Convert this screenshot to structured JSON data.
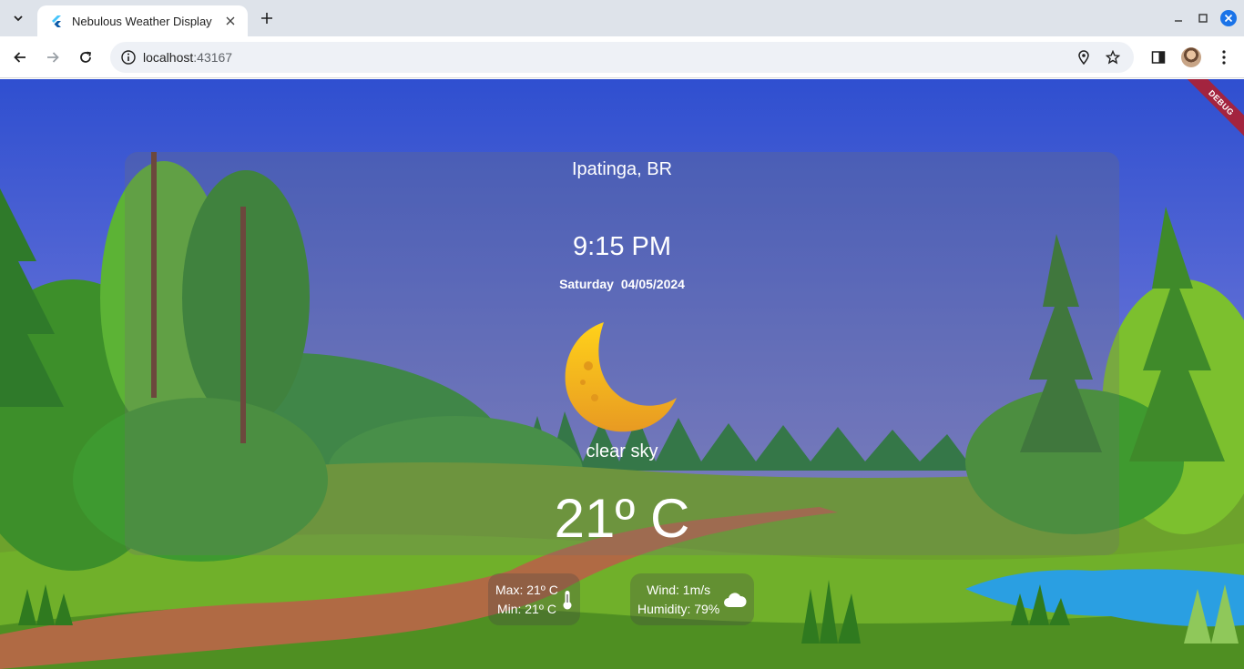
{
  "browser": {
    "tab_title": "Nebulous Weather Display",
    "url_host": "localhost",
    "url_port": ":43167"
  },
  "app": {
    "debug_label": "DEBUG",
    "city": "Ipatinga, BR",
    "time": "9:15 PM",
    "date": "Saturday  04/05/2024",
    "condition": "clear sky",
    "temperature": "21º C",
    "max_temp": "Max: 21º C",
    "min_temp": "Min: 21º C",
    "wind": "Wind: 1m/s",
    "humidity": "Humidity: 79%"
  },
  "icons": {
    "weather": "moon-icon",
    "temp_range": "thermometer-icon",
    "wind_humidity": "cloud-icon"
  },
  "colors": {
    "sky_top": "#2f4fd0",
    "sky_bottom": "#7a7fd8",
    "grass": "#6fb52a",
    "moon": "#f2b41e",
    "debug_banner": "#a3243f"
  }
}
